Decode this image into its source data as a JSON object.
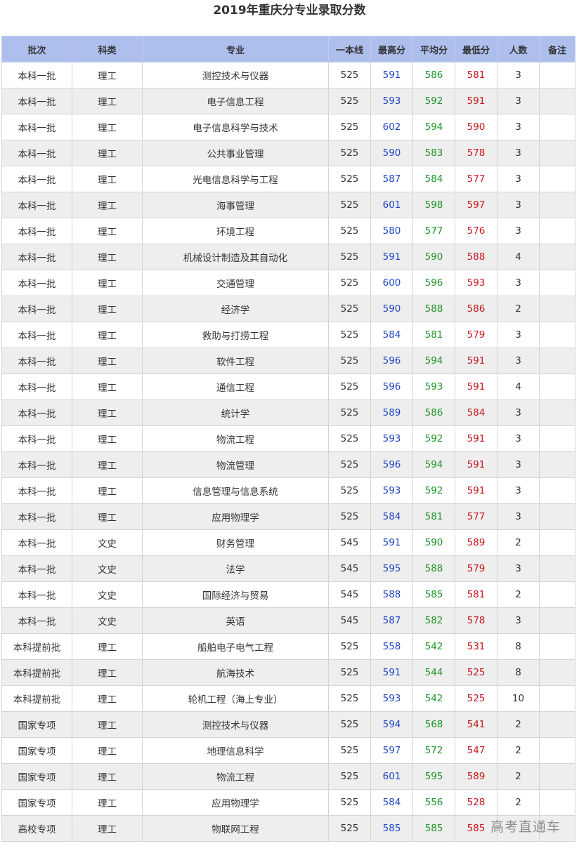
{
  "title": "2019年重庆分专业录取分数",
  "headers": [
    "批次",
    "科类",
    "专业",
    "一本线",
    "最高分",
    "平均分",
    "最低分",
    "人数",
    "备注"
  ],
  "colors": {
    "header_bg": "#aebfee",
    "max": "#1f45c7",
    "avg": "#1e9428",
    "min": "#c8161d",
    "stripe": "#eeeeee"
  },
  "rows": [
    {
      "batch": "本科一批",
      "category": "理工",
      "major": "测控技术与仪器",
      "line": "525",
      "max": "591",
      "avg": "586",
      "min": "581",
      "count": "3",
      "note": ""
    },
    {
      "batch": "本科一批",
      "category": "理工",
      "major": "电子信息工程",
      "line": "525",
      "max": "593",
      "avg": "592",
      "min": "591",
      "count": "3",
      "note": ""
    },
    {
      "batch": "本科一批",
      "category": "理工",
      "major": "电子信息科学与技术",
      "line": "525",
      "max": "602",
      "avg": "594",
      "min": "590",
      "count": "3",
      "note": ""
    },
    {
      "batch": "本科一批",
      "category": "理工",
      "major": "公共事业管理",
      "line": "525",
      "max": "590",
      "avg": "583",
      "min": "578",
      "count": "3",
      "note": ""
    },
    {
      "batch": "本科一批",
      "category": "理工",
      "major": "光电信息科学与工程",
      "line": "525",
      "max": "587",
      "avg": "584",
      "min": "577",
      "count": "3",
      "note": ""
    },
    {
      "batch": "本科一批",
      "category": "理工",
      "major": "海事管理",
      "line": "525",
      "max": "601",
      "avg": "598",
      "min": "597",
      "count": "3",
      "note": ""
    },
    {
      "batch": "本科一批",
      "category": "理工",
      "major": "环境工程",
      "line": "525",
      "max": "580",
      "avg": "577",
      "min": "576",
      "count": "3",
      "note": ""
    },
    {
      "batch": "本科一批",
      "category": "理工",
      "major": "机械设计制造及其自动化",
      "line": "525",
      "max": "591",
      "avg": "590",
      "min": "588",
      "count": "4",
      "note": ""
    },
    {
      "batch": "本科一批",
      "category": "理工",
      "major": "交通管理",
      "line": "525",
      "max": "600",
      "avg": "596",
      "min": "593",
      "count": "3",
      "note": ""
    },
    {
      "batch": "本科一批",
      "category": "理工",
      "major": "经济学",
      "line": "525",
      "max": "590",
      "avg": "588",
      "min": "586",
      "count": "2",
      "note": ""
    },
    {
      "batch": "本科一批",
      "category": "理工",
      "major": "救助与打捞工程",
      "line": "525",
      "max": "584",
      "avg": "581",
      "min": "579",
      "count": "3",
      "note": ""
    },
    {
      "batch": "本科一批",
      "category": "理工",
      "major": "软件工程",
      "line": "525",
      "max": "596",
      "avg": "594",
      "min": "591",
      "count": "3",
      "note": ""
    },
    {
      "batch": "本科一批",
      "category": "理工",
      "major": "通信工程",
      "line": "525",
      "max": "596",
      "avg": "593",
      "min": "591",
      "count": "4",
      "note": ""
    },
    {
      "batch": "本科一批",
      "category": "理工",
      "major": "统计学",
      "line": "525",
      "max": "589",
      "avg": "586",
      "min": "584",
      "count": "3",
      "note": ""
    },
    {
      "batch": "本科一批",
      "category": "理工",
      "major": "物流工程",
      "line": "525",
      "max": "593",
      "avg": "592",
      "min": "591",
      "count": "3",
      "note": ""
    },
    {
      "batch": "本科一批",
      "category": "理工",
      "major": "物流管理",
      "line": "525",
      "max": "596",
      "avg": "594",
      "min": "591",
      "count": "3",
      "note": ""
    },
    {
      "batch": "本科一批",
      "category": "理工",
      "major": "信息管理与信息系统",
      "line": "525",
      "max": "593",
      "avg": "592",
      "min": "591",
      "count": "3",
      "note": ""
    },
    {
      "batch": "本科一批",
      "category": "理工",
      "major": "应用物理学",
      "line": "525",
      "max": "584",
      "avg": "581",
      "min": "577",
      "count": "3",
      "note": ""
    },
    {
      "batch": "本科一批",
      "category": "文史",
      "major": "财务管理",
      "line": "545",
      "max": "591",
      "avg": "590",
      "min": "589",
      "count": "2",
      "note": ""
    },
    {
      "batch": "本科一批",
      "category": "文史",
      "major": "法学",
      "line": "545",
      "max": "595",
      "avg": "588",
      "min": "579",
      "count": "3",
      "note": ""
    },
    {
      "batch": "本科一批",
      "category": "文史",
      "major": "国际经济与贸易",
      "line": "545",
      "max": "588",
      "avg": "585",
      "min": "581",
      "count": "2",
      "note": ""
    },
    {
      "batch": "本科一批",
      "category": "文史",
      "major": "英语",
      "line": "545",
      "max": "587",
      "avg": "582",
      "min": "578",
      "count": "3",
      "note": ""
    },
    {
      "batch": "本科提前批",
      "category": "理工",
      "major": "船舶电子电气工程",
      "line": "525",
      "max": "558",
      "avg": "542",
      "min": "531",
      "count": "8",
      "note": ""
    },
    {
      "batch": "本科提前批",
      "category": "理工",
      "major": "航海技术",
      "line": "525",
      "max": "591",
      "avg": "544",
      "min": "525",
      "count": "8",
      "note": ""
    },
    {
      "batch": "本科提前批",
      "category": "理工",
      "major": "轮机工程（海上专业）",
      "line": "525",
      "max": "593",
      "avg": "542",
      "min": "525",
      "count": "10",
      "note": ""
    },
    {
      "batch": "国家专项",
      "category": "理工",
      "major": "测控技术与仪器",
      "line": "525",
      "max": "594",
      "avg": "568",
      "min": "541",
      "count": "2",
      "note": ""
    },
    {
      "batch": "国家专项",
      "category": "理工",
      "major": "地理信息科学",
      "line": "525",
      "max": "597",
      "avg": "572",
      "min": "547",
      "count": "2",
      "note": ""
    },
    {
      "batch": "国家专项",
      "category": "理工",
      "major": "物流工程",
      "line": "525",
      "max": "601",
      "avg": "595",
      "min": "589",
      "count": "2",
      "note": ""
    },
    {
      "batch": "国家专项",
      "category": "理工",
      "major": "应用物理学",
      "line": "525",
      "max": "584",
      "avg": "556",
      "min": "528",
      "count": "2",
      "note": ""
    },
    {
      "batch": "高校专项",
      "category": "理工",
      "major": "物联网工程",
      "line": "525",
      "max": "585",
      "avg": "585",
      "min": "585",
      "count": "",
      "note": ""
    }
  ],
  "watermark": "高考直通车"
}
